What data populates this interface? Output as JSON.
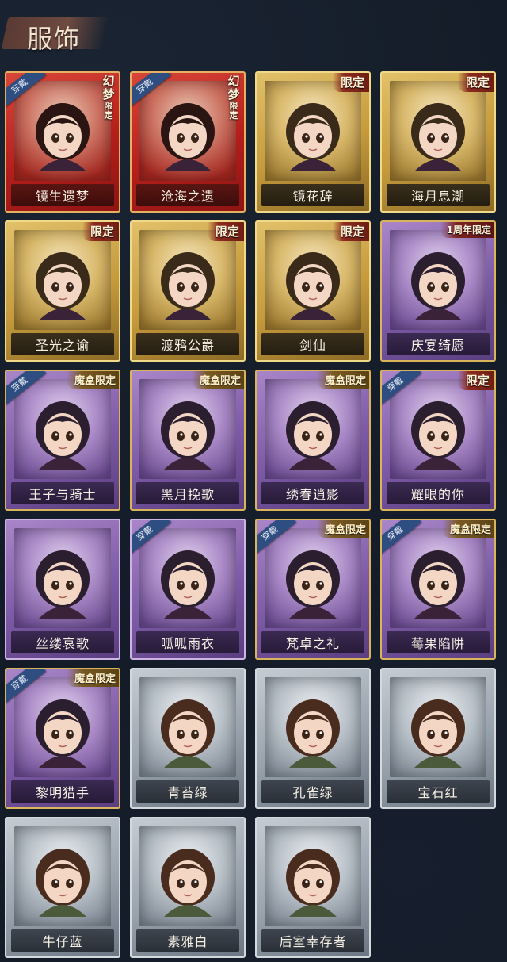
{
  "header": {
    "title": "服饰"
  },
  "colors": {
    "background": "#131a26",
    "red_frame": "#b51f1c",
    "gold_frame": "#c59a3c",
    "purple_frame": "#7d5aa6",
    "gray_frame": "#98a2ad",
    "wear_tag": "#2e4d80"
  },
  "costumes": [
    {
      "name": "镜生遗梦",
      "rarity": "red",
      "badge": "幻梦限定",
      "worn": true
    },
    {
      "name": "沧海之遗",
      "rarity": "red",
      "badge": "幻梦限定",
      "worn": true
    },
    {
      "name": "镜花辞",
      "rarity": "gold",
      "badge": "限定",
      "worn": false
    },
    {
      "name": "海月息潮",
      "rarity": "gold",
      "badge": "限定",
      "worn": false
    },
    {
      "name": "圣光之谕",
      "rarity": "gold",
      "badge": "限定",
      "worn": false
    },
    {
      "name": "渡鸦公爵",
      "rarity": "gold",
      "badge": "限定",
      "worn": false
    },
    {
      "name": "剑仙",
      "rarity": "gold",
      "badge": "限定",
      "worn": false
    },
    {
      "name": "庆宴绮愿",
      "rarity": "purple",
      "badge": "1周年限定",
      "worn": false
    },
    {
      "name": "王子与骑士",
      "rarity": "purple",
      "badge": "魔盒限定",
      "worn": true
    },
    {
      "name": "黑月挽歌",
      "rarity": "purple",
      "badge": "魔盒限定",
      "worn": false
    },
    {
      "name": "绣春逍影",
      "rarity": "purple",
      "badge": "魔盒限定",
      "worn": false
    },
    {
      "name": "耀眼的你",
      "rarity": "purple",
      "badge": "限定",
      "worn": true
    },
    {
      "name": "丝缕哀歌",
      "rarity": "purple",
      "badge": "",
      "worn": false
    },
    {
      "name": "呱呱雨衣",
      "rarity": "purple",
      "badge": "",
      "worn": true
    },
    {
      "name": "梵卓之礼",
      "rarity": "purple",
      "badge": "魔盒限定",
      "worn": true
    },
    {
      "name": "莓果陷阱",
      "rarity": "purple",
      "badge": "魔盒限定",
      "worn": true
    },
    {
      "name": "黎明猎手",
      "rarity": "purple",
      "badge": "魔盒限定",
      "worn": true
    },
    {
      "name": "青苔绿",
      "rarity": "gray",
      "badge": "",
      "worn": false
    },
    {
      "name": "孔雀绿",
      "rarity": "gray",
      "badge": "",
      "worn": false
    },
    {
      "name": "宝石红",
      "rarity": "gray",
      "badge": "",
      "worn": false
    },
    {
      "name": "牛仔蓝",
      "rarity": "gray",
      "badge": "",
      "worn": false
    },
    {
      "name": "素雅白",
      "rarity": "gray",
      "badge": "",
      "worn": false
    },
    {
      "name": "后室幸存者",
      "rarity": "gray",
      "badge": "",
      "worn": false
    }
  ],
  "labels": {
    "wear_tag": "穿戴"
  }
}
